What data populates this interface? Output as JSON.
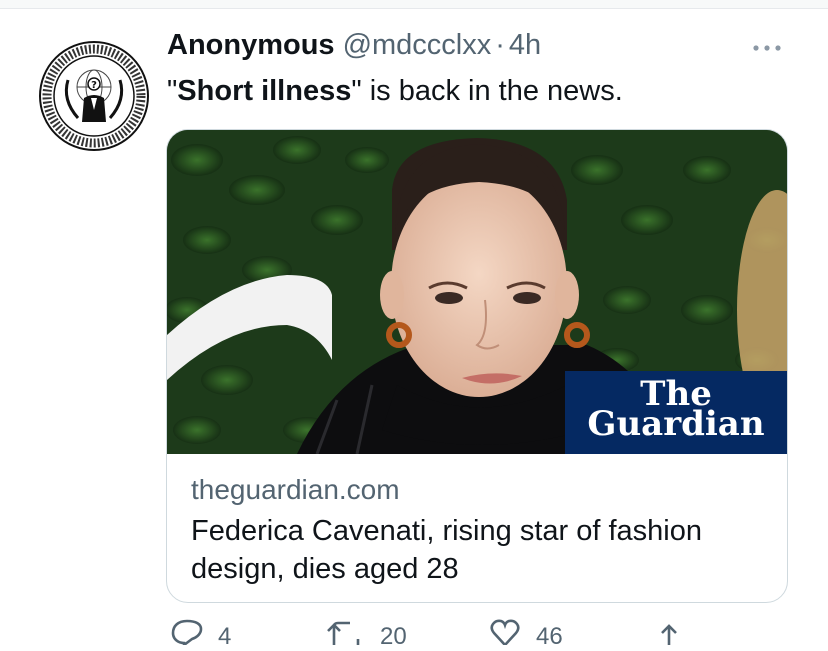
{
  "tweet": {
    "display_name": "Anonymous",
    "handle": "@mdccclxx",
    "separator": "·",
    "time": "4h",
    "text_quoted": "Short illness",
    "text_rest": " is back in the news.",
    "quote_open": "\"",
    "quote_close": "\"",
    "avatar_icon": "anonymous-logo-icon"
  },
  "card": {
    "badge_line1": "The",
    "badge_line2": "Guardian",
    "domain": "theguardian.com",
    "title": "Federica Cavenati, rising star of fashion design, dies aged 28"
  },
  "actions": {
    "reply_count": "4",
    "retweet_count": "20",
    "like_count": "46"
  },
  "colors": {
    "text": "#0f1419",
    "secondary": "#536471",
    "border": "#cfd9de",
    "guardian_blue": "#052962"
  }
}
